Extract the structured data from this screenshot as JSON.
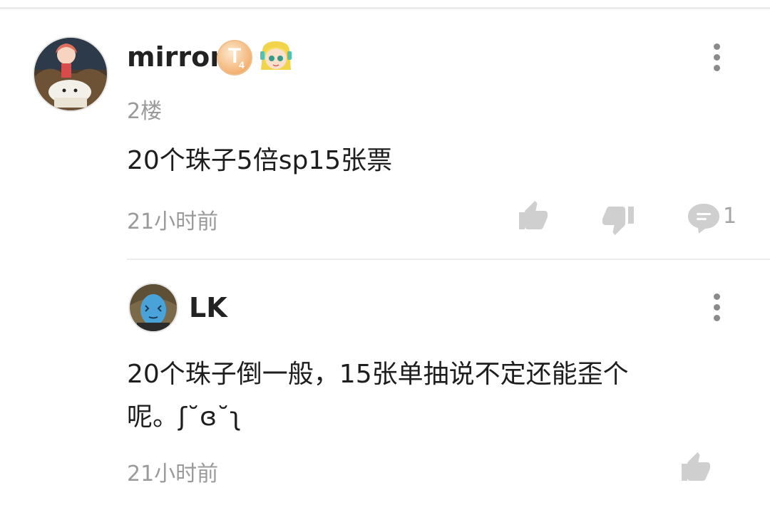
{
  "comment": {
    "username": "mirror",
    "floor": "2楼",
    "content": "20个珠子5倍sp15张票",
    "time": "21小时前",
    "reply_count": "1",
    "icons": {
      "avatar": "anime-avatar",
      "level_badge": "level-badge-icon",
      "medal": "anime-girl-medal-icon",
      "more": "more-vertical-icon",
      "like": "thumbs-up-icon",
      "dislike": "thumbs-down-icon",
      "reply": "comment-bubble-icon"
    }
  },
  "reply": {
    "username": "LK",
    "content_line1": "20个珠子倒一般，15张单抽说不定还能歪个",
    "content_line2": "呢。ʃ˘ɞ˘ʅ",
    "time": "21小时前",
    "icons": {
      "avatar": "blue-face-avatar",
      "more": "more-vertical-icon",
      "like": "thumbs-up-icon"
    }
  },
  "colors": {
    "text_primary": "#1e1e1e",
    "text_secondary": "#9a9a9a",
    "icon_gray": "#cfcfcf",
    "divider": "#ededed"
  }
}
